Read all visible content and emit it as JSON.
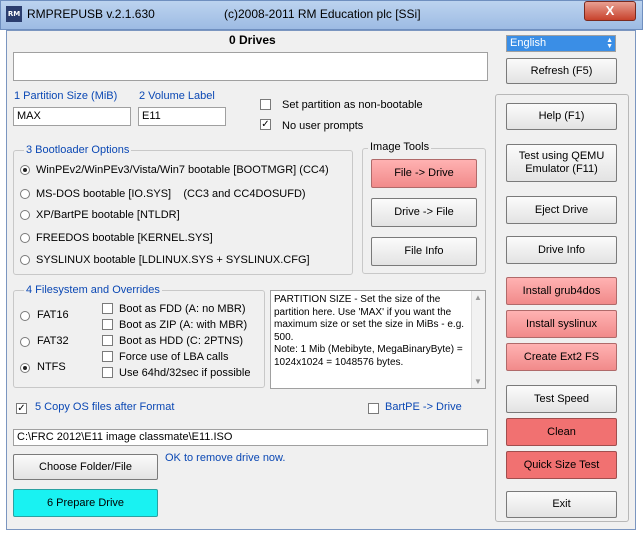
{
  "titlebar": {
    "app_name": "RMPREPUSB v.2.1.630",
    "copyright": "(c)2008-2011 RM Education plc [SSi]",
    "icon_text": "RM",
    "close": "X"
  },
  "drives": {
    "header": "0 Drives",
    "list_value": ""
  },
  "language": {
    "value": "English",
    "refresh": "Refresh (F5)"
  },
  "partition": {
    "size_label": "1 Partition Size (MiB)",
    "size_value": "MAX",
    "volume_label": "2 Volume Label",
    "volume_value": "E11"
  },
  "options": {
    "non_bootable": "Set partition as non-bootable",
    "no_prompts": "No user prompts",
    "no_prompts_checked": true
  },
  "bootloader": {
    "title": "3 Bootloader Options",
    "items": [
      {
        "label": "WinPEv2/WinPEv3/Vista/Win7 bootable [BOOTMGR] (CC4)",
        "selected": true
      },
      {
        "label": "MS-DOS bootable [IO.SYS]    (CC3 and CC4DOSUFD)",
        "selected": false
      },
      {
        "label": "XP/BartPE bootable [NTLDR]",
        "selected": false
      },
      {
        "label": "FREEDOS bootable [KERNEL.SYS]",
        "selected": false
      },
      {
        "label": "SYSLINUX bootable [LDLINUX.SYS + SYSLINUX.CFG]",
        "selected": false
      }
    ]
  },
  "image_tools": {
    "title": "Image Tools",
    "file_to_drive": "File -> Drive",
    "drive_to_file": "Drive -> File",
    "file_info": "File Info"
  },
  "filesystem": {
    "title": "4 Filesystem and Overrides",
    "types": [
      {
        "label": "FAT16",
        "selected": false
      },
      {
        "label": "FAT32",
        "selected": false
      },
      {
        "label": "NTFS",
        "selected": true
      }
    ],
    "overrides": [
      "Boot as FDD (A: no MBR)",
      "Boot as ZIP (A: with MBR)",
      "Boot as HDD (C: 2PTNS)",
      "Force use of LBA calls",
      "Use 64hd/32sec if possible"
    ]
  },
  "help_text": "PARTITION SIZE - Set the size of the partition here. Use 'MAX' if you want the maximum size or set the size in MiBs - e.g. 500.\nNote: 1 Mib (Mebibyte, MegaBinaryByte) = 1024x1024 = 1048576 bytes.",
  "copy": {
    "label": "5 Copy OS files after Format",
    "checked": true,
    "bartpe": "BartPE -> Drive"
  },
  "path": {
    "value": "C:\\FRC 2012\\E11 image classmate\\E11.ISO"
  },
  "choose_folder": "Choose Folder/File",
  "status": "OK to remove drive now.",
  "prepare": "6 Prepare Drive",
  "right_buttons": {
    "help": "Help (F1)",
    "qemu": "Test using QEMU Emulator (F11)",
    "eject": "Eject Drive",
    "drive_info": "Drive Info",
    "grub4dos": "Install grub4dos",
    "syslinux": "Install syslinux",
    "ext2": "Create Ext2 FS",
    "test_speed": "Test Speed",
    "clean": "Clean",
    "quick_size": "Quick Size Test",
    "exit": "Exit"
  },
  "colors": {
    "title_blue": "#0b48b4",
    "pink": "#f18a8a",
    "red": "#f17171",
    "cyan": "#19f2f2"
  }
}
